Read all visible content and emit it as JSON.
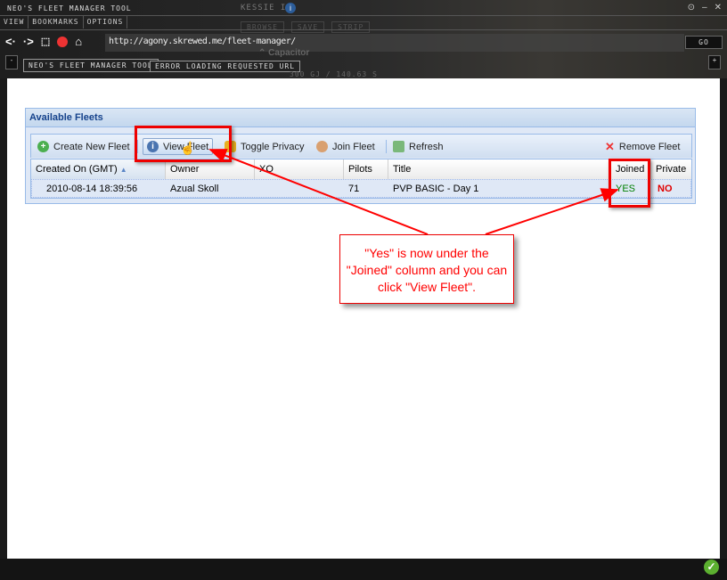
{
  "window": {
    "title": "NEO'S FLEET MANAGER TOOL",
    "menu": [
      "VIEW",
      "BOOKMARKS",
      "OPTIONS"
    ],
    "url": "http://agony.skrewed.me/fleet-manager/",
    "go_label": "GO",
    "tabs": [
      "NEO'S FLEET MANAGER TOOL",
      "ERROR LOADING REQUESTED URL"
    ]
  },
  "background": {
    "ship_name": "KESSIE I",
    "buttons": [
      "BROWSE",
      "SAVE",
      "STRIP"
    ],
    "capacitor_label": "Capacitor",
    "capacitor_value": "300 GJ / 140.63 s"
  },
  "panel": {
    "title": "Available Fleets",
    "toolbar": {
      "create": "Create New Fleet",
      "view": "View Fleet",
      "toggle": "Toggle Privacy",
      "join": "Join Fleet",
      "refresh": "Refresh",
      "remove": "Remove Fleet"
    },
    "columns": [
      "Created On (GMT)",
      "Owner",
      "XO",
      "Pilots",
      "Title",
      "Joined",
      "Private"
    ],
    "rows": [
      {
        "created": "2010-08-14 18:39:56",
        "owner": "Azual Skoll",
        "xo": "",
        "pilots": "71",
        "title": "PVP BASIC - Day 1",
        "joined": "YES",
        "private": "NO"
      }
    ]
  },
  "annotation": {
    "text": "\"Yes\" is now under the \"Joined\" column and you can click \"View Fleet\".",
    "color": "#ff0000"
  },
  "colors": {
    "yes": "#008000",
    "no": "#e00000",
    "panel_title": "#15428b"
  }
}
